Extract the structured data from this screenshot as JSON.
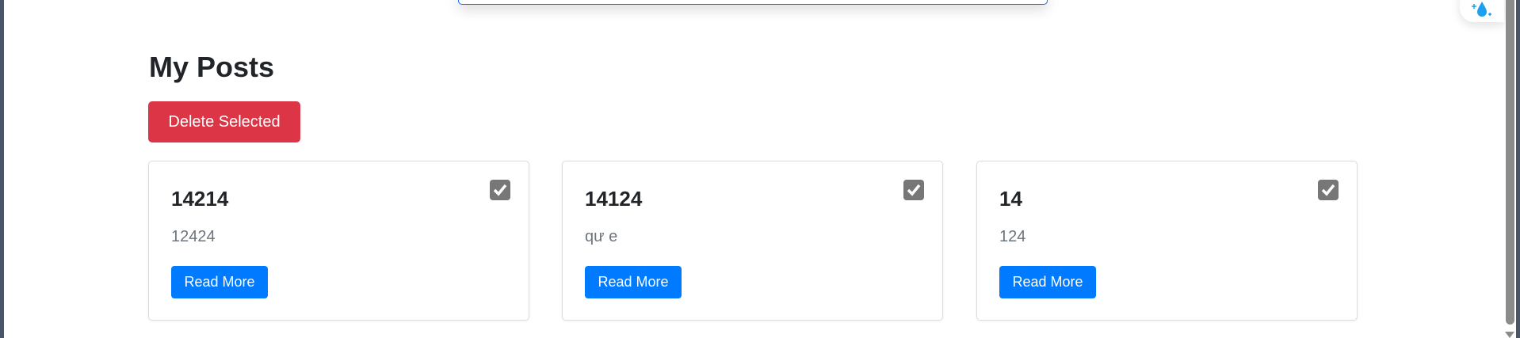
{
  "page_title": "My Posts",
  "delete_selected_label": "Delete Selected",
  "colors": {
    "danger": "#dc3545",
    "primary": "#007bff"
  },
  "posts": [
    {
      "title": "14214",
      "body": "12424",
      "read_more": "Read More",
      "checked": true
    },
    {
      "title": "14124",
      "body": "qư e",
      "read_more": "Read More",
      "checked": true
    },
    {
      "title": "14",
      "body": "124",
      "read_more": "Read More",
      "checked": true
    }
  ]
}
